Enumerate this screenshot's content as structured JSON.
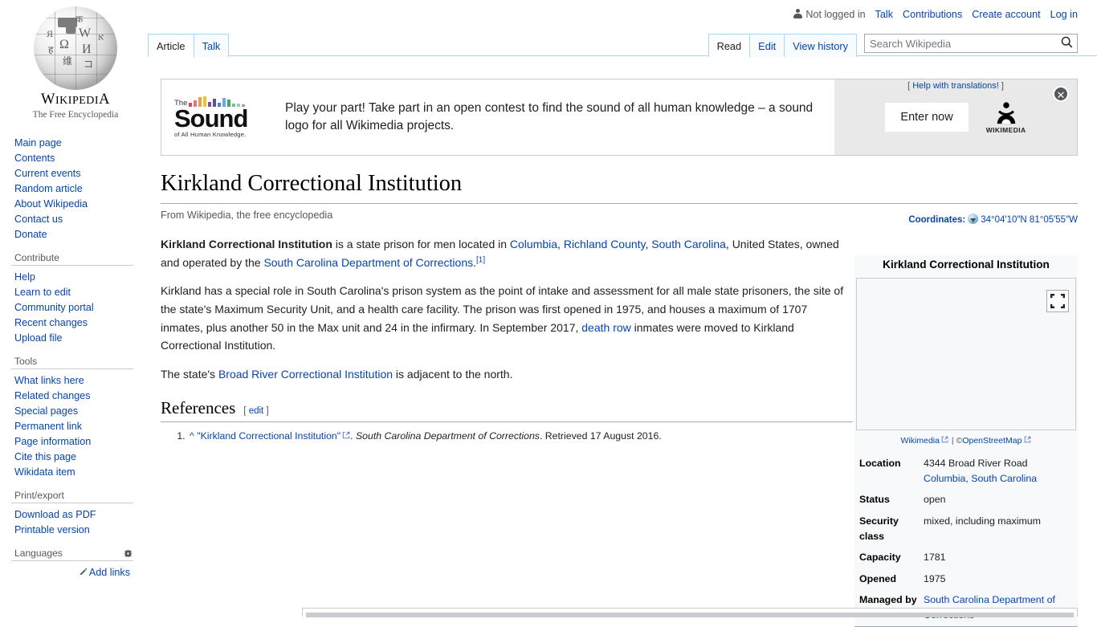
{
  "personal_bar": {
    "user_status": "Not logged in",
    "links": [
      "Talk",
      "Contributions",
      "Create account",
      "Log in"
    ]
  },
  "logo": {
    "wordmark_big": "W",
    "wordmark_rest": "IKIPEDI",
    "wordmark_last": "A",
    "tagline": "The Free Encyclopedia",
    "globe_glyphs": [
      "W",
      "Ω",
      "И",
      "维",
      "コ",
      "Я",
      "א",
      "ह",
      "क"
    ]
  },
  "sidebar": {
    "sections": [
      {
        "heading": "",
        "items": [
          "Main page",
          "Contents",
          "Current events",
          "Random article",
          "About Wikipedia",
          "Contact us",
          "Donate"
        ]
      },
      {
        "heading": "Contribute",
        "items": [
          "Help",
          "Learn to edit",
          "Community portal",
          "Recent changes",
          "Upload file"
        ]
      },
      {
        "heading": "Tools",
        "items": [
          "What links here",
          "Related changes",
          "Special pages",
          "Permanent link",
          "Page information",
          "Cite this page",
          "Wikidata item"
        ]
      },
      {
        "heading": "Print/export",
        "items": [
          "Download as PDF",
          "Printable version"
        ]
      },
      {
        "heading": "Languages",
        "items": []
      }
    ],
    "add_links": "Add links"
  },
  "tabs": {
    "namespaces": [
      {
        "label": "Article",
        "selected": true
      },
      {
        "label": "Talk",
        "selected": false
      }
    ],
    "views": [
      {
        "label": "Read",
        "selected": true
      },
      {
        "label": "Edit",
        "selected": false
      },
      {
        "label": "View history",
        "selected": false
      }
    ]
  },
  "search": {
    "placeholder": "Search Wikipedia",
    "value": ""
  },
  "banner": {
    "logo_the": "The",
    "logo_word": "Sound",
    "logo_sub": "of All Human Knowledge.",
    "message": "Play your part! Take part in an open contest to find the sound of all human knowledge – a sound logo for all Wikimedia projects.",
    "help_open": "[",
    "help_text": "Help with translations!",
    "help_close": "]",
    "cta": "Enter now",
    "wikimedia_label": "WIKIMEDIA",
    "close": "✕",
    "bar_colors": [
      "#d94a4a",
      "#e8718d",
      "#e8a33d",
      "#f0c330",
      "#7b4fa0",
      "#5b4fa0",
      "#4a7fd9",
      "#6aa9e8",
      "#3fa66f",
      "#6fbf8f",
      "#8fd1a8",
      "#9aa0a6"
    ]
  },
  "article": {
    "title": "Kirkland Correctional Institution",
    "site_sub": "From Wikipedia, the free encyclopedia",
    "coordinates_label": "Coordinates:",
    "coordinates_value": "34°04′10″N 81°05′55″W",
    "paragraph1": {
      "bold_lead": "Kirkland Correctional Institution",
      "t1": " is a state prison for men located in ",
      "link1": "Columbia",
      "t2": ", ",
      "link2": "Richland County",
      "t3": ", ",
      "link3": "South Carolina",
      "t4": ", United States, owned and operated by the ",
      "link4": "South Carolina Department of Corrections",
      "t5": ".",
      "ref": "[1]"
    },
    "paragraph2": {
      "t1": "Kirkland has a special role in South Carolina's prison system as the point of intake and assessment for all male state prisoners, the site of the state's Maximum Security Unit, and a health care facility. The prison was first opened in 1975, and houses a maximum of 1707 inmates, plus another 50 in the Max unit and 24 in the infirmary. In September 2017, ",
      "link1": "death row",
      "t2": " inmates were moved to Kirkland Correctional Institution."
    },
    "paragraph3": {
      "t1": "The state's ",
      "link1": "Broad River Correctional Institution",
      "t2": " is adjacent to the north."
    },
    "references_heading": "References",
    "edit_open": "[",
    "edit_label": "edit",
    "edit_close": "]",
    "reference_1": {
      "backlink": "^",
      "title": "\"Kirkland Correctional Institution\"",
      "work": "South Carolina Department of Corrections",
      "retrieved": ". Retrieved 17 August 2016."
    }
  },
  "infobox": {
    "title": "Kirkland Correctional Institution",
    "map_attrib_wikimedia": "Wikimedia",
    "map_attrib_sep": "|",
    "map_attrib_osm_prefix": "©",
    "map_attrib_osm": "OpenStreetMap",
    "rows": [
      {
        "label": "Location",
        "value_lines": [
          "4344 Broad River Road"
        ],
        "value_link": "Columbia, South Carolina"
      },
      {
        "label": "Status",
        "value_lines": [
          "open"
        ],
        "value_link": ""
      },
      {
        "label": "Security class",
        "value_lines": [
          "mixed, including maximum"
        ],
        "value_link": ""
      },
      {
        "label": "Capacity",
        "value_lines": [
          "1781"
        ],
        "value_link": ""
      },
      {
        "label": "Opened",
        "value_lines": [
          "1975"
        ],
        "value_link": ""
      },
      {
        "label": "Managed by",
        "value_lines": [],
        "value_link": "South Carolina Department of Corrections"
      }
    ]
  },
  "colors": {
    "link": "#0645ad",
    "tab_border": "#a7d7f9",
    "text": "#202122",
    "muted": "#54595d"
  }
}
